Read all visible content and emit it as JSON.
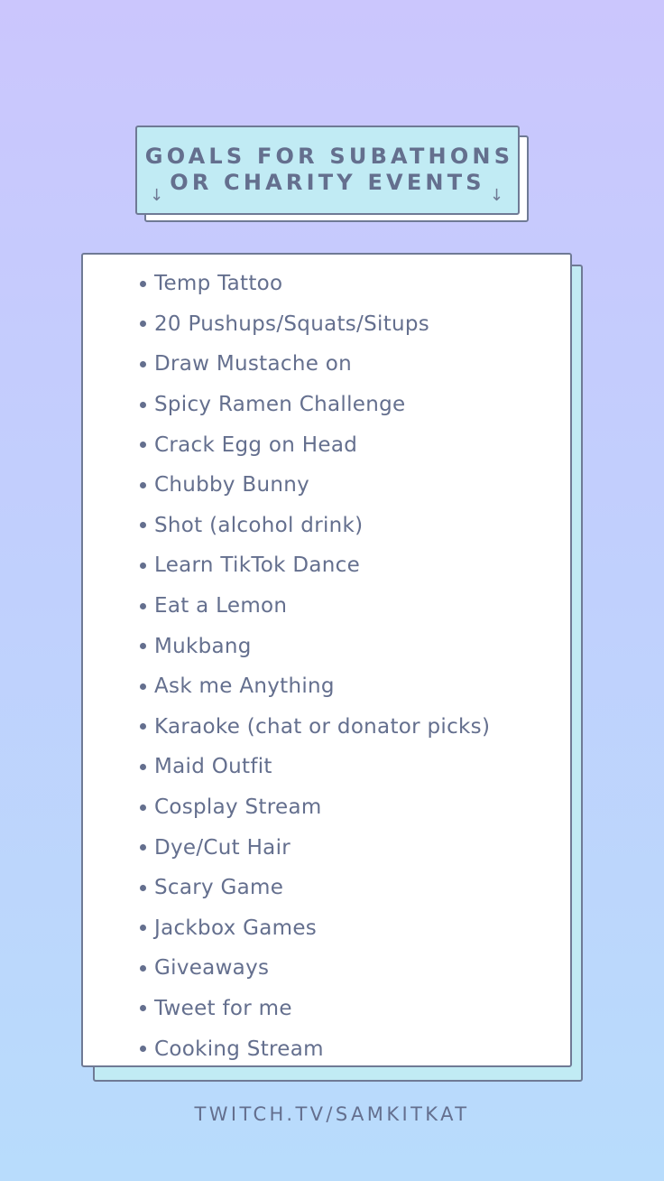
{
  "header": {
    "title_line_1": "GOALS FOR SUBATHONS",
    "title_line_2": "OR CHARITY EVENTS",
    "arrow_icon_glyph": "↓",
    "arrow_icon_name": "arrow-down-icon"
  },
  "goals": [
    "Temp Tattoo",
    "20 Pushups/Squats/Situps",
    "Draw Mustache on",
    "Spicy Ramen Challenge",
    "Crack Egg on Head",
    "Chubby Bunny",
    "Shot (alcohol drink)",
    "Learn TikTok Dance",
    "Eat a Lemon",
    "Mukbang",
    "Ask me Anything",
    "Karaoke (chat or donator picks)",
    "Maid Outfit",
    "Cosplay Stream",
    "Dye/Cut Hair",
    "Scary Game",
    "Jackbox Games",
    "Giveaways",
    "Tweet for me",
    "Cooking Stream"
  ],
  "footer": {
    "link_text": "TWITCH.TV/SAMKITKAT"
  },
  "colors": {
    "background_top": "#cbc6fd",
    "background_bottom": "#b8dcfc",
    "text": "#646f8e",
    "border": "#6f7a95",
    "title_fill": "#c1ebf4",
    "list_fill": "#ffffff",
    "list_shadow_fill": "#c1ebf4"
  }
}
